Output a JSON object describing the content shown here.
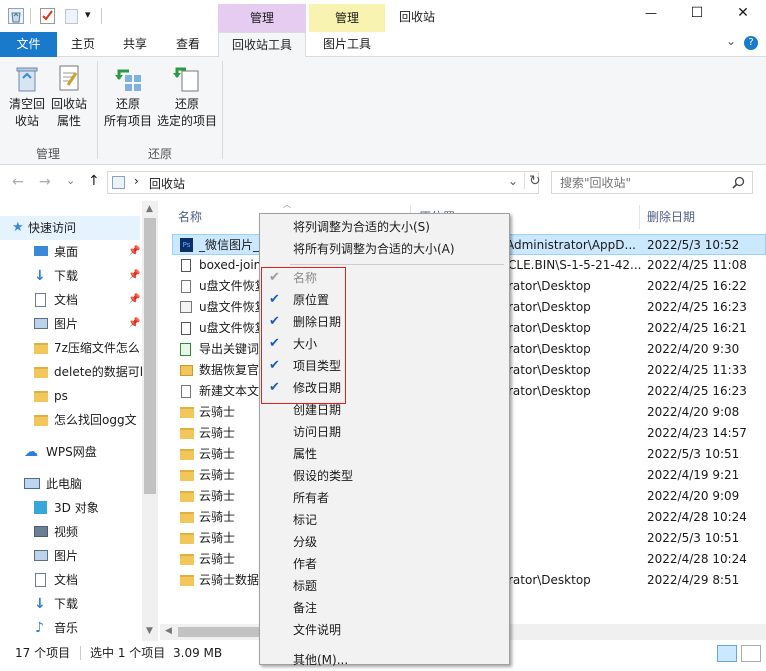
{
  "titlebar": {
    "title": "回收站",
    "manage1": "管理",
    "manage2": "管理",
    "qa_dropdown": "▾",
    "minimize": "—",
    "maximize": "☐",
    "close": "✕"
  },
  "ribbon_tabs": {
    "file": "文件",
    "home": "主页",
    "share": "共享",
    "view": "查看",
    "recycle_tools": "回收站工具",
    "picture_tools": "图片工具",
    "expand": "⌄",
    "help": "?"
  },
  "ribbon": {
    "empty_line1": "清空回",
    "empty_line2": "收站",
    "props_line1": "回收站",
    "props_line2": "属性",
    "group_manage": "管理",
    "restore_all_line1": "还原",
    "restore_all_line2": "所有项目",
    "restore_sel_line1": "还原",
    "restore_sel_line2": "选定的项目",
    "group_restore": "还原"
  },
  "address": {
    "back": "←",
    "forward": "→",
    "recent": "⌄",
    "up": "↑",
    "separator": "›",
    "path": "回收站",
    "dropdown": "⌄",
    "refresh": "↻",
    "search_placeholder": "搜索\"回收站\""
  },
  "sidebar": {
    "quick_access": "快速访问",
    "desktop": "桌面",
    "downloads": "下载",
    "documents": "文档",
    "pictures": "图片",
    "f1": "7z压缩文件怎么",
    "f2": "delete的数据可l",
    "f3": "ps",
    "f4": "怎么找回ogg文",
    "wps": "WPS网盘",
    "this_pc": "此电脑",
    "objects3d": "3D 对象",
    "videos": "视频",
    "pictures2": "图片",
    "documents2": "文档",
    "downloads2": "下载",
    "music": "音乐"
  },
  "columns": {
    "name": "名称",
    "location": "原位置",
    "deleted": "删除日期"
  },
  "rows": [
    {
      "name": "_微信图片_",
      "location": "Administrator\\AppD...",
      "date": "2022/5/3 10:52"
    },
    {
      "name": "boxed-join",
      "location": "CLE.BIN\\S-1-5-21-42...",
      "date": "2022/4/25 11:08"
    },
    {
      "name": "u盘文件恢复",
      "location": "rator\\Desktop",
      "date": "2022/4/25 16:22"
    },
    {
      "name": "u盘文件恢复",
      "location": "rator\\Desktop",
      "date": "2022/4/25 16:23"
    },
    {
      "name": "u盘文件恢复",
      "location": "rator\\Desktop",
      "date": "2022/4/25 16:21"
    },
    {
      "name": "导出关键词",
      "location": "rator\\Desktop",
      "date": "2022/4/20 9:30"
    },
    {
      "name": "数据恢复官",
      "location": "rator\\Desktop",
      "date": "2022/4/25 11:33"
    },
    {
      "name": "新建文本文",
      "location": "rator\\Desktop",
      "date": "2022/4/25 16:23"
    },
    {
      "name": "云骑士",
      "location": "",
      "date": "2022/4/20 9:08"
    },
    {
      "name": "云骑士",
      "location": "",
      "date": "2022/4/23 14:57"
    },
    {
      "name": "云骑士",
      "location": "",
      "date": "2022/5/3 10:51"
    },
    {
      "name": "云骑士",
      "location": "",
      "date": "2022/4/19 9:21"
    },
    {
      "name": "云骑士",
      "location": "",
      "date": "2022/4/20 9:09"
    },
    {
      "name": "云骑士",
      "location": "",
      "date": "2022/4/28 10:24"
    },
    {
      "name": "云骑士",
      "location": "",
      "date": "2022/5/3 10:51"
    },
    {
      "name": "云骑士",
      "location": "",
      "date": "2022/4/28 10:24"
    },
    {
      "name": "云骑士数据",
      "location": "rator\\Desktop",
      "date": "2022/4/29 8:51"
    }
  ],
  "menu": {
    "fit_col": "将列调整为合适的大小(S)",
    "fit_all": "将所有列调整为合适的大小(A)",
    "check": "✔",
    "items": [
      {
        "label": "名称",
        "checked": true,
        "disabled": true
      },
      {
        "label": "原位置",
        "checked": true
      },
      {
        "label": "删除日期",
        "checked": true
      },
      {
        "label": "大小",
        "checked": true
      },
      {
        "label": "项目类型",
        "checked": true
      },
      {
        "label": "修改日期",
        "checked": true
      },
      {
        "label": "创建日期",
        "checked": false
      },
      {
        "label": "访问日期",
        "checked": false
      },
      {
        "label": "属性",
        "checked": false
      },
      {
        "label": "假设的类型",
        "checked": false
      },
      {
        "label": "所有者",
        "checked": false
      },
      {
        "label": "标记",
        "checked": false
      },
      {
        "label": "分级",
        "checked": false
      },
      {
        "label": "作者",
        "checked": false
      },
      {
        "label": "标题",
        "checked": false
      },
      {
        "label": "备注",
        "checked": false
      },
      {
        "label": "文件说明",
        "checked": false
      },
      {
        "label": "其他(M)...",
        "checked": false
      }
    ]
  },
  "status": {
    "count": "17 个项目",
    "selected": "选中 1 个项目",
    "size": "3.09 MB"
  },
  "colors": {
    "accent": "#1979ca",
    "context_manage1": "#e6ccf0",
    "context_manage2": "#f8f3b0",
    "selection": "#cce8ff",
    "highlight_box": "#e02020"
  }
}
